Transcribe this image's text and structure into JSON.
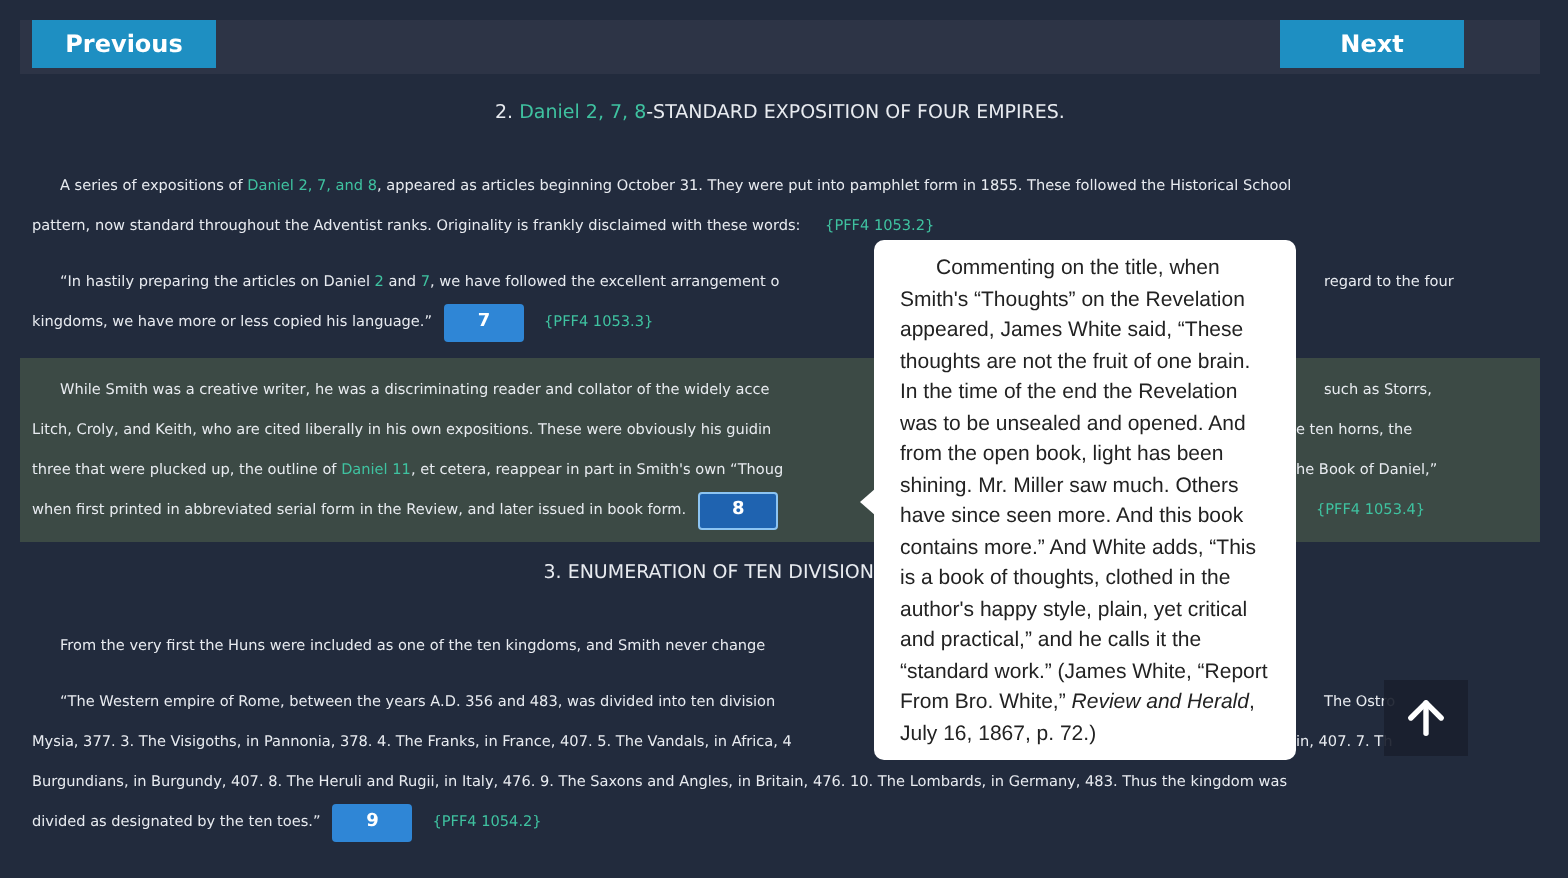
{
  "nav": {
    "previous": "Previous",
    "next": "Next"
  },
  "blocks": [
    {
      "kind": "heading",
      "highlighted": false,
      "lines": [
        {
          "left": [
            {
              "kind": "text",
              "text": "2. "
            },
            {
              "kind": "link",
              "text": "Daniel 2, 7, 8"
            },
            {
              "kind": "text",
              "text": "-STANDARD EXPOSITION OF FOUR EMPIRES."
            }
          ]
        }
      ]
    },
    {
      "kind": "paragraph",
      "highlighted": false,
      "lines": [
        {
          "left": [
            {
              "kind": "text",
              "text": "A series of expositions of "
            },
            {
              "kind": "link",
              "text": "Daniel 2, 7, and 8"
            },
            {
              "kind": "text",
              "text": ", appeared as articles beginning October 31. They were put into pamphlet form in 1855. These followed the Historical School"
            }
          ]
        },
        {
          "left": [
            {
              "kind": "text",
              "text": "pattern, now standard throughout the Adventist ranks. Originality is frankly disclaimed with these words: "
            },
            {
              "kind": "ref",
              "text": "{PFF4 1053.2}"
            }
          ]
        }
      ]
    },
    {
      "kind": "paragraph",
      "highlighted": false,
      "lines": [
        {
          "covered": true,
          "left": [
            {
              "kind": "text",
              "text": "“In hastily preparing the articles on Daniel "
            },
            {
              "kind": "link",
              "text": "2"
            },
            {
              "kind": "text",
              "text": " and "
            },
            {
              "kind": "link",
              "text": "7"
            },
            {
              "kind": "text",
              "text": ", we have followed the excellent arrangement o"
            }
          ],
          "right": [
            {
              "kind": "text",
              "text": "regard to the four"
            }
          ]
        },
        {
          "left": [
            {
              "kind": "text",
              "text": "kingdoms, we have more or less copied his language.”"
            },
            {
              "kind": "button",
              "text": "7",
              "selected": false
            },
            {
              "kind": "ref",
              "text": "{PFF4 1053.3}"
            }
          ]
        }
      ]
    },
    {
      "kind": "paragraph",
      "highlighted": true,
      "lines": [
        {
          "covered": true,
          "left": [
            {
              "kind": "text",
              "text": "While Smith was a creative writer, he was a discriminating reader and collator of the widely acce"
            }
          ],
          "right": [
            {
              "kind": "text",
              "text": "such as Storrs,"
            }
          ]
        },
        {
          "covered": true,
          "left": [
            {
              "kind": "text",
              "text": "Litch, Croly, and Keith, who are cited liberally in his own expositions. These were obviously his guidin"
            }
          ],
          "right": [
            {
              "kind": "text",
              "text": "e ten horns, the"
            }
          ]
        },
        {
          "covered": true,
          "left": [
            {
              "kind": "text",
              "text": "three that were plucked up, the outline of "
            },
            {
              "kind": "link",
              "text": "Daniel 11"
            },
            {
              "kind": "text",
              "text": ", et cetera, reappear in part in Smith's own “Thoug"
            }
          ],
          "right": [
            {
              "kind": "text",
              "text": "he Book of Daniel,”"
            }
          ]
        },
        {
          "covered": true,
          "left": [
            {
              "kind": "text",
              "text": "when first printed in abbreviated serial form in the Review, and later issued in book form."
            },
            {
              "kind": "button",
              "text": "8",
              "selected": true
            }
          ],
          "right": [
            {
              "kind": "ref",
              "text": "{PFF4 1053.4}"
            }
          ]
        }
      ]
    },
    {
      "kind": "heading",
      "highlighted": false,
      "lines": [
        {
          "covered": true,
          "left": [
            {
              "kind": "text",
              "text": "3. ENUMERATION OF TEN DIVISION"
            }
          ]
        }
      ]
    },
    {
      "kind": "paragraph",
      "highlighted": false,
      "lines": [
        {
          "left": [
            {
              "kind": "text",
              "text": "From the very first the Huns were included as one of the ten kingdoms, and Smith never change"
            }
          ]
        }
      ]
    },
    {
      "kind": "paragraph",
      "highlighted": false,
      "lines": [
        {
          "covered": true,
          "left": [
            {
              "kind": "text",
              "text": "“The Western empire of Rome, between the years A.D. 356 and 483, was divided into ten division"
            }
          ],
          "right": [
            {
              "kind": "text",
              "text": "The Ostro"
            }
          ]
        },
        {
          "covered": true,
          "left": [
            {
              "kind": "text",
              "text": "Mysia, 377. 3. The Visigoths, in Pannonia, 378. 4. The Franks, in France, 407. 5. The Vandals, in Africa, 4"
            }
          ],
          "right": [
            {
              "kind": "text",
              "text": "in, 407. 7. Th"
            }
          ]
        },
        {
          "left": [
            {
              "kind": "text",
              "text": "Burgundians, in Burgundy, 407. 8. The Heruli and Rugii, in Italy, 476. 9. The Saxons and Angles, in Britain, 476. 10. The Lombards, in Germany, 483. Thus the kingdom was"
            }
          ]
        },
        {
          "left": [
            {
              "kind": "text",
              "text": "divided as designated by the ten toes.”"
            },
            {
              "kind": "button",
              "text": "9",
              "selected": false
            },
            {
              "kind": "ref",
              "text": "{PFF4 1054.2}"
            }
          ]
        }
      ]
    }
  ],
  "tooltip": {
    "text": "Commenting on the title, when Smith's “Thoughts” on the Revelation appeared, James White said, “These thoughts are not the fruit of one brain. In the time of the end the Revelation was to be unsealed and opened. And from the open book, light has been shining. Mr. Miller saw much. Others have since seen more. And this book contains more.” And White adds, “This is a book of thoughts, clothed in the author's happy style, plain, yet critical and practical,” and he calls it the “standard work.” (James White, “Report From Bro. White,” *Review and Herald*, July 16, 1867, p. 72.)"
  }
}
